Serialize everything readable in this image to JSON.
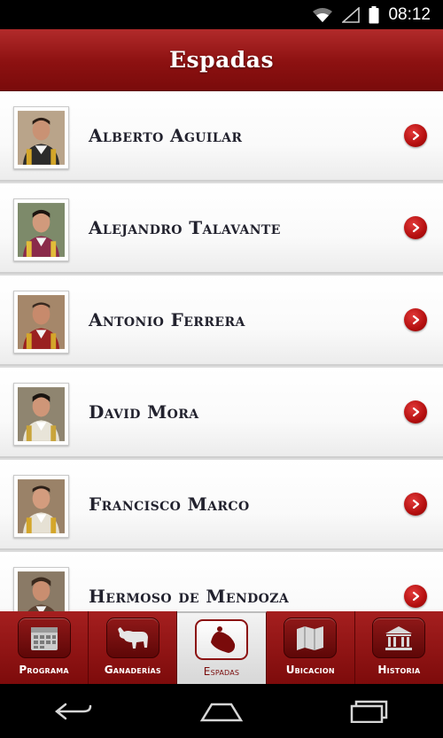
{
  "status_bar": {
    "time": "08:12"
  },
  "header": {
    "title": "Espadas"
  },
  "list": {
    "items": [
      {
        "name": "Alberto Aguilar"
      },
      {
        "name": "Alejandro Talavante"
      },
      {
        "name": "Antonio Ferrera"
      },
      {
        "name": "David Mora"
      },
      {
        "name": "Francisco Marco"
      },
      {
        "name": "Hermoso de Mendoza"
      }
    ]
  },
  "tabs": [
    {
      "label": "Programa",
      "icon": "calendar-icon"
    },
    {
      "label": "Ganaderías",
      "icon": "bull-icon"
    },
    {
      "label": "Espadas",
      "icon": "cape-icon",
      "active": true
    },
    {
      "label": "Ubicacion",
      "icon": "map-icon"
    },
    {
      "label": "Historia",
      "icon": "museum-icon"
    }
  ],
  "colors": {
    "brand": "#8c1111",
    "accent": "#b40f0f",
    "active_tab": "#e5e5e5"
  }
}
